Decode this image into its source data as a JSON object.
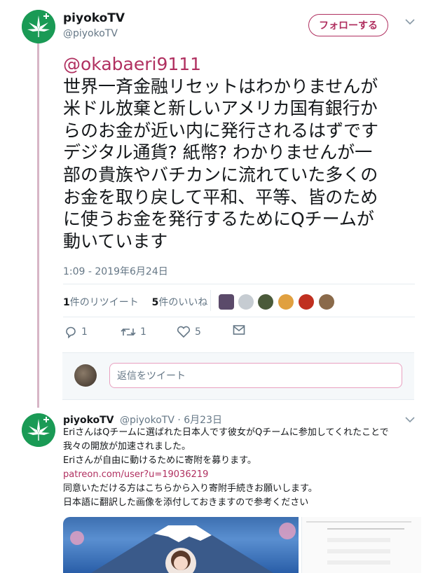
{
  "tweet": {
    "display_name": "piyokoTV",
    "handle": "@piyokoTV",
    "follow_label": "フォローする",
    "mention": "@okabaeri9111",
    "body_lines": [
      "世界一斉金融リセットはわかりませんが",
      "米ドル放棄と新しいアメリカ国有銀行か",
      "らのお金が近い内に発行されるはずです",
      "デジタル通貨? 紙幣? わかりませんが一",
      "部の貴族やバチカンに流れていた多くの",
      "お金を取り戻して平和、平等、皆のため",
      "に使うお金を発行するためにQチームが",
      "動いています"
    ],
    "timestamp": "1:09 - 2019年6月24日",
    "retweets_count": "1",
    "retweets_label": "件のリツイート",
    "likes_count": "5",
    "likes_label": "件のいいね",
    "reply_count": "1",
    "retweet_count": "1",
    "like_count": "5",
    "reply_placeholder": "返信をツイート",
    "colors": {
      "accent": "#b03060",
      "avatar_green": "#1a9a55",
      "thread_line": "#d7b5c6"
    }
  },
  "reply_tweet": {
    "display_name": "piyokoTV",
    "handle_date": "@piyokoTV · 6月23日",
    "lines": [
      "EriさんはQチームに選ばれた日本人です彼女がQチームに参加してくれたことで",
      "我々の開放が加速されました。",
      "Eriさんが自由に動けるために寄附を募ります。"
    ],
    "link": "patreon.com/user?u=19036219",
    "lines_after": [
      "同意いただける方はこちらから入り寄附手続きお願いします。",
      "日本語に翻訳した画像を添付しておきますので参考ください"
    ]
  }
}
